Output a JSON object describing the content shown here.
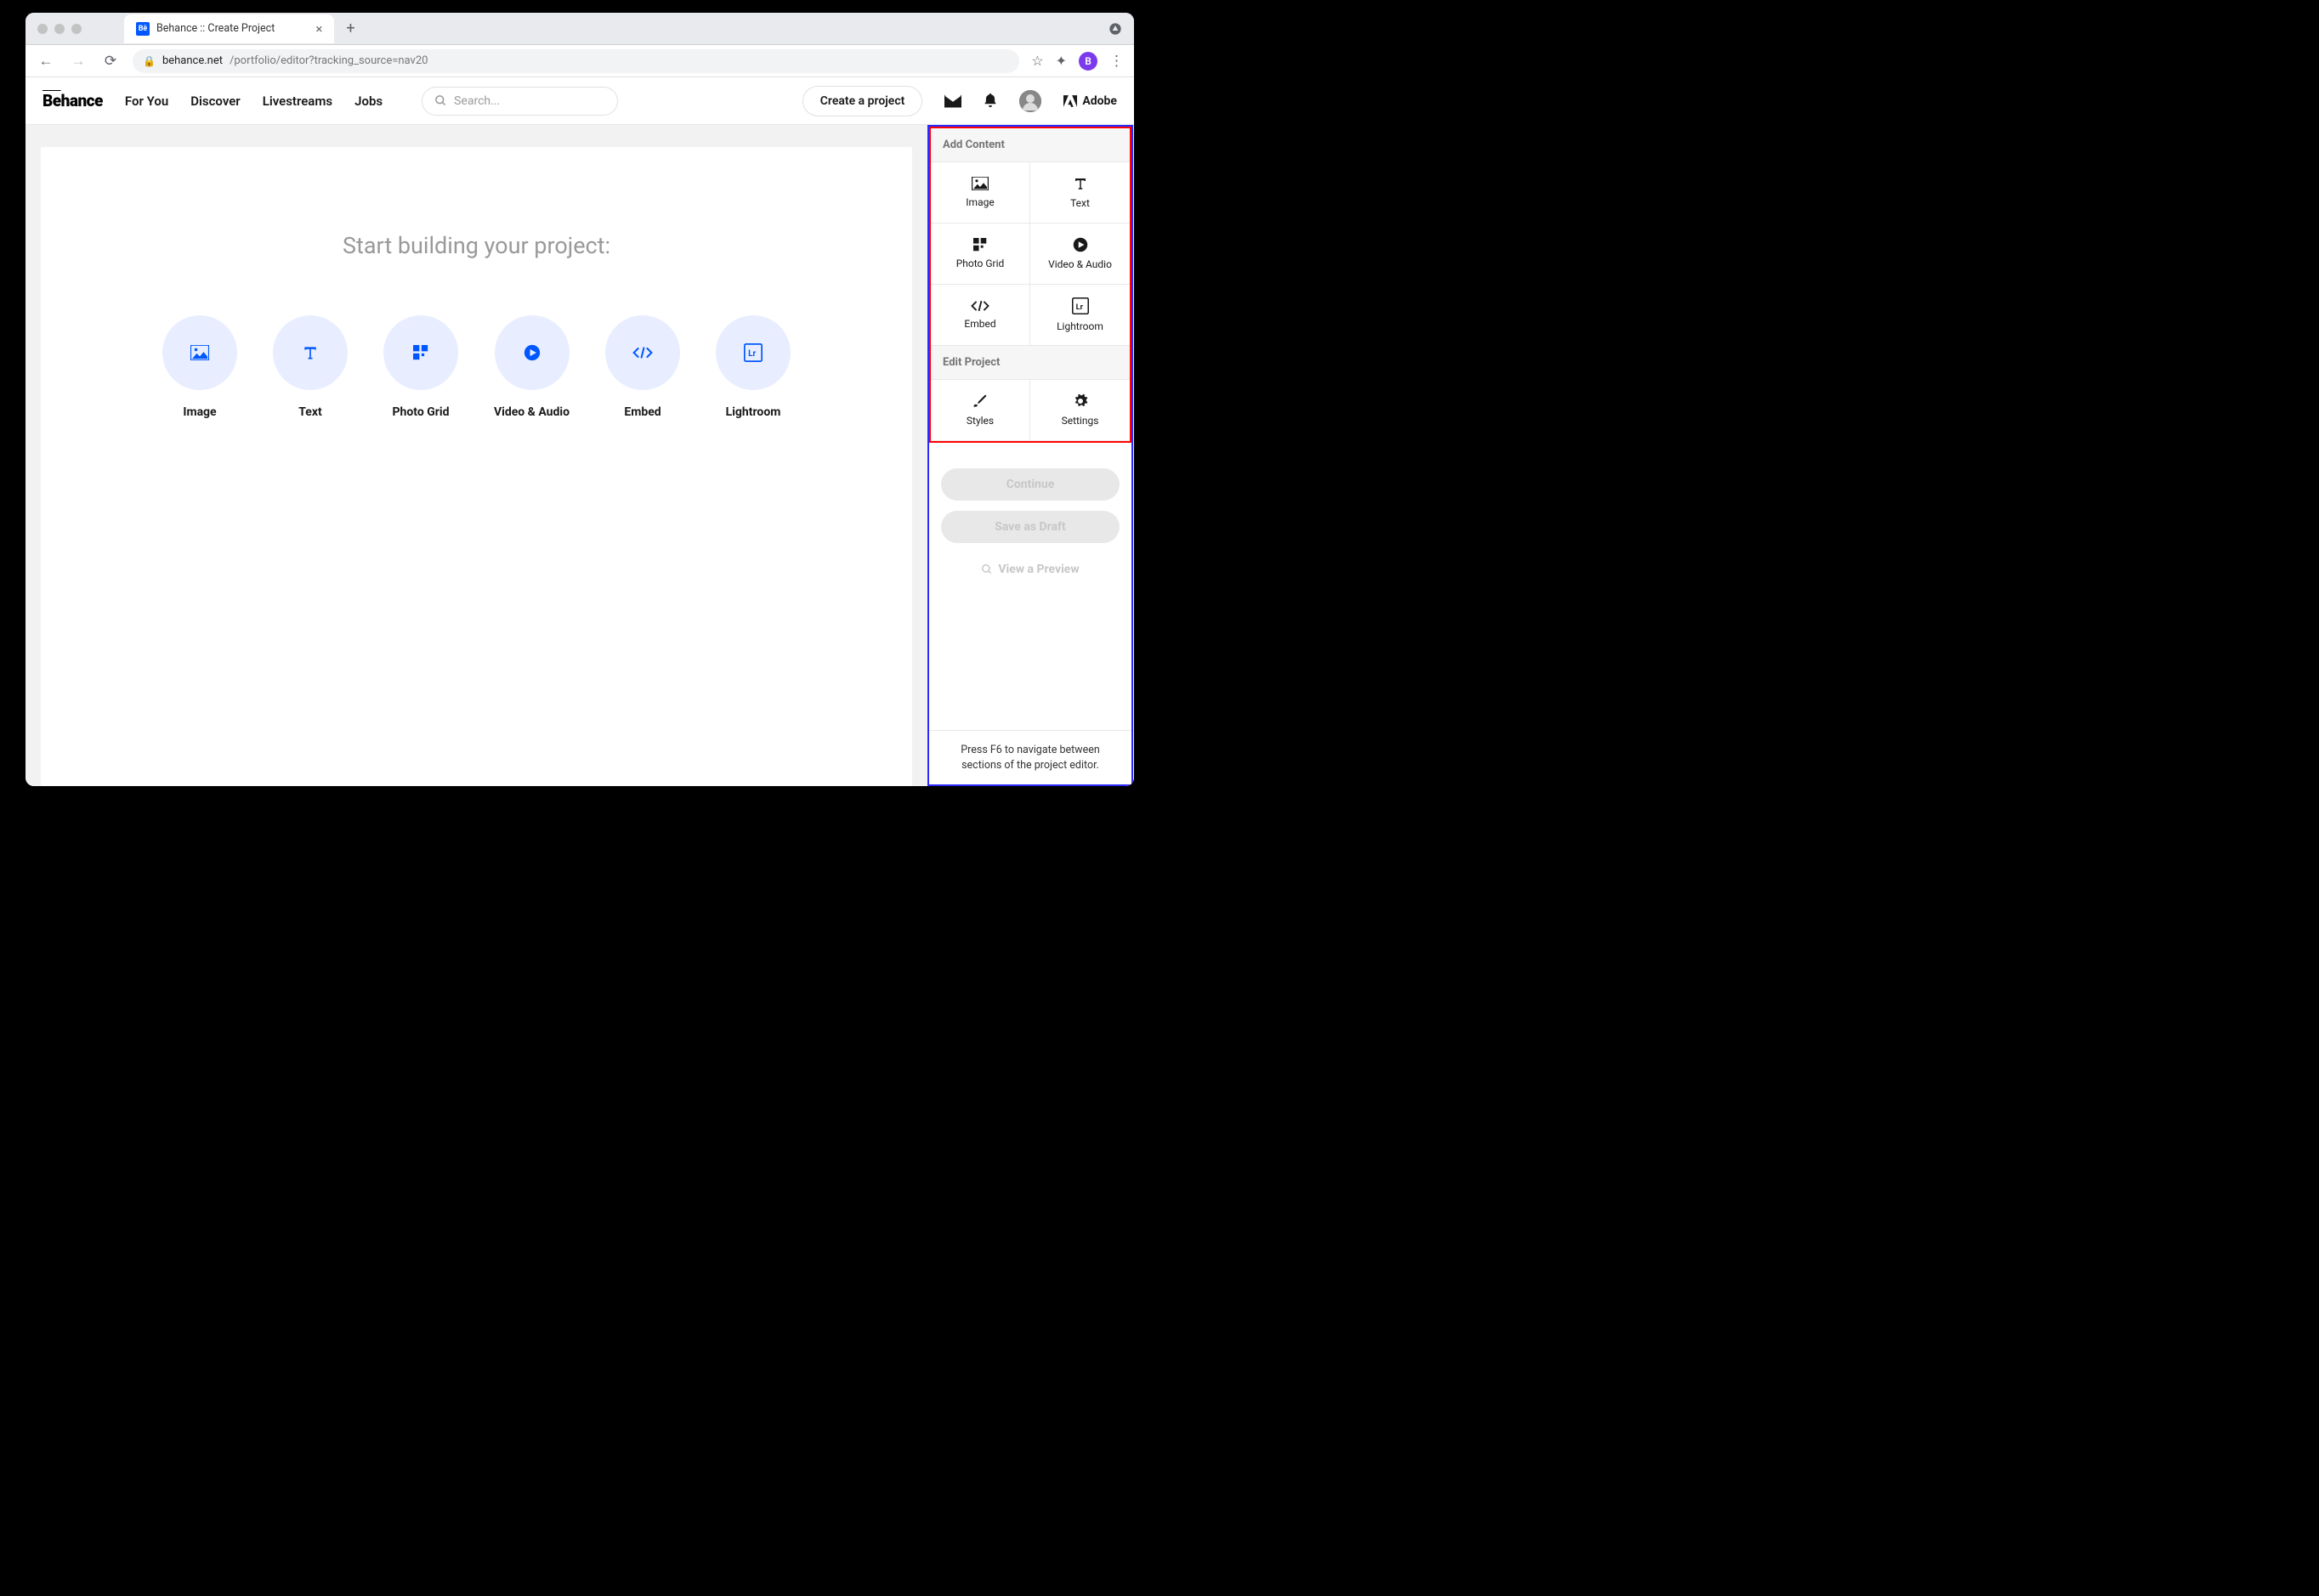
{
  "browser": {
    "tab_title": "Behance :: Create Project",
    "url_domain": "behance.net",
    "url_path": "/portfolio/editor?tracking_source=nav20"
  },
  "header": {
    "logo": "Bēhance",
    "nav": [
      "For You",
      "Discover",
      "Livestreams",
      "Jobs"
    ],
    "search_placeholder": "Search...",
    "create_label": "Create a project",
    "adobe_label": "Adobe"
  },
  "canvas": {
    "prompt": "Start building your project:",
    "types": [
      {
        "label": "Image"
      },
      {
        "label": "Text"
      },
      {
        "label": "Photo Grid"
      },
      {
        "label": "Video & Audio"
      },
      {
        "label": "Embed"
      },
      {
        "label": "Lightroom"
      }
    ]
  },
  "sidebar": {
    "add_content_header": "Add Content",
    "add_items": [
      {
        "label": "Image"
      },
      {
        "label": "Text"
      },
      {
        "label": "Photo Grid"
      },
      {
        "label": "Video & Audio"
      },
      {
        "label": "Embed"
      },
      {
        "label": "Lightroom"
      }
    ],
    "edit_header": "Edit Project",
    "edit_items": [
      {
        "label": "Styles"
      },
      {
        "label": "Settings"
      }
    ],
    "continue_label": "Continue",
    "draft_label": "Save as Draft",
    "preview_label": "View a Preview",
    "hint": "Press F6 to navigate between sections of the project editor."
  }
}
